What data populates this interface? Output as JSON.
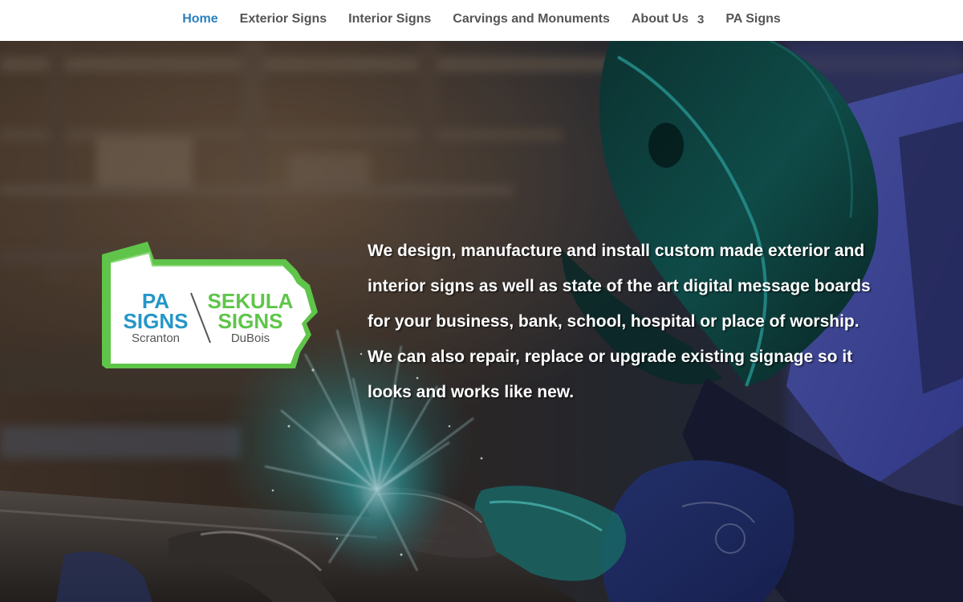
{
  "nav": {
    "items": [
      {
        "label": "Home",
        "active": true
      },
      {
        "label": "Exterior Signs",
        "active": false
      },
      {
        "label": "Interior Signs",
        "active": false
      },
      {
        "label": "Carvings and Monuments",
        "active": false
      },
      {
        "label": "About Us",
        "active": false,
        "badge": "3"
      },
      {
        "label": "PA Signs",
        "active": false
      }
    ],
    "active_color": "#2a7fbe",
    "text_color": "#555555"
  },
  "hero": {
    "background": "welding-workshop-photo",
    "text": "We design, manufacture and install custom made exterior and interior signs as well as state of the art digital message boards for your business, bank, school, hospital or place of worship. We can also repair, replace or upgrade existing signage so it looks and works like new."
  },
  "logo": {
    "left_top": "PA",
    "left_bottom": "SIGNS",
    "left_city": "Scranton",
    "right_top": "SEKULA",
    "right_bottom": "SIGNS",
    "right_city": "DuBois",
    "green": "#5fc54a",
    "blue": "#2596c8",
    "gray": "#555555"
  }
}
